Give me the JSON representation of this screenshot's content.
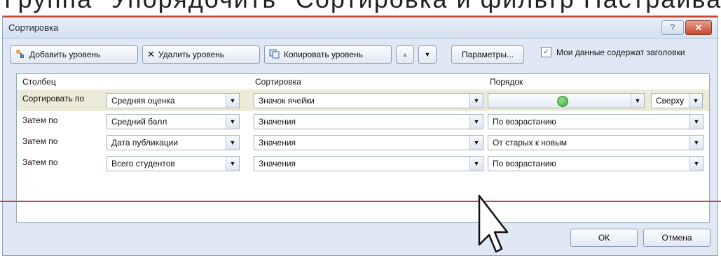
{
  "window": {
    "title": "Сортировка",
    "help_label": "?",
    "close_label": "✕"
  },
  "background_strip": {
    "text": "Группа \"Упорядочить\" Сортировка и фильтр Настраиваемая сортировка"
  },
  "toolbar": {
    "add_level_label": "Добавить уровень",
    "delete_level_label": "Удалить уровень",
    "copy_level_label": "Копировать уровень",
    "move_up_label": "▲",
    "move_down_label": "▼",
    "options_label": "Параметры...",
    "headers_checkbox_label": "Мои данные содержат заголовки",
    "headers_checked": true
  },
  "grid": {
    "headers": {
      "column": "Столбец",
      "sort_on": "Сортировка",
      "order": "Порядок"
    },
    "rows": [
      {
        "label": "Сортировать по",
        "column": "Средняя оценка",
        "sort_on": "Значок ячейки",
        "order": "",
        "order_icon": "green-circle",
        "position": "Сверху"
      },
      {
        "label": "Затем по",
        "column": "Средний балл",
        "sort_on": "Значения",
        "order": "По возрастанию"
      },
      {
        "label": "Затем по",
        "column": "Дата публикации",
        "sort_on": "Значения",
        "order": "От старых к новым"
      },
      {
        "label": "Затем по",
        "column": "Всего студентов",
        "sort_on": "Значения",
        "order": "По возрастанию"
      }
    ]
  },
  "footer": {
    "ok_label": "ОК",
    "cancel_label": "Отмена"
  },
  "colors": {
    "accent_line": "#c4472a",
    "dialog_bg": "#dfe8f4",
    "selected_row": "#ecebd9"
  }
}
